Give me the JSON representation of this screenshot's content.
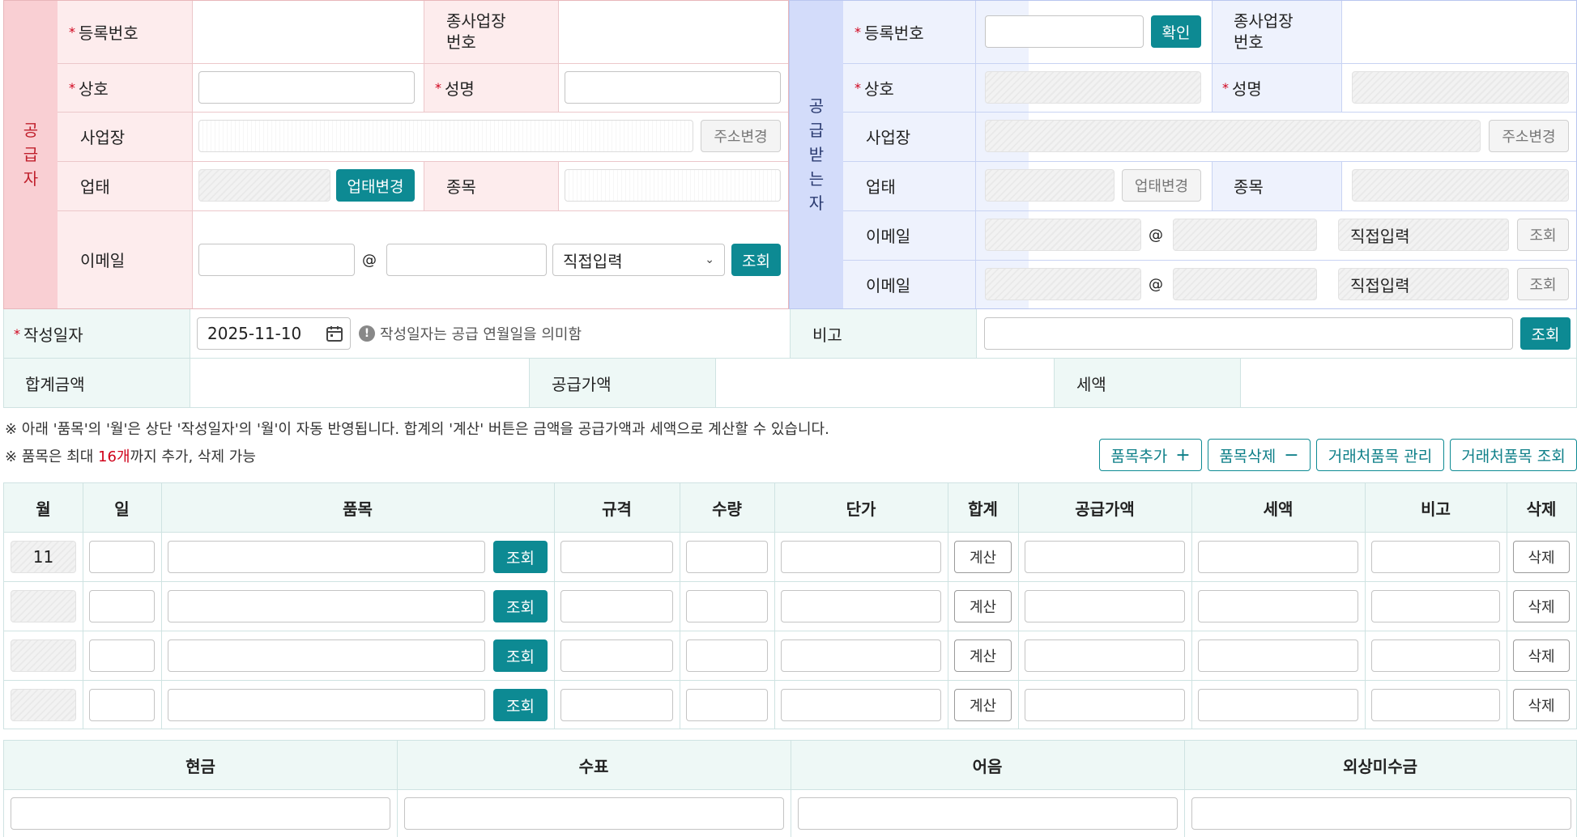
{
  "supplier": {
    "side_label": [
      "공",
      "급",
      "자"
    ],
    "reg_no": "등록번호",
    "branch_no": "종사업장\n번호",
    "company": "상호",
    "name": "성명",
    "address": "사업장",
    "addr_change": "주소변경",
    "biz_type": "업태",
    "biz_change": "업태변경",
    "biz_item": "종목",
    "email": "이메일",
    "at": "@",
    "email_domain": "직접입력",
    "lookup": "조회"
  },
  "receiver": {
    "side_label": [
      "공",
      "급",
      "받",
      "는",
      "자"
    ],
    "reg_no": "등록번호",
    "confirm": "확인",
    "branch_no": "종사업장\n번호",
    "company": "상호",
    "name": "성명",
    "address": "사업장",
    "addr_change": "주소변경",
    "biz_type": "업태",
    "biz_change": "업태변경",
    "biz_item": "종목",
    "email1": "이메일",
    "email2": "이메일",
    "at": "@",
    "email_domain": "직접입력",
    "lookup": "조회"
  },
  "date_row": {
    "label": "작성일자",
    "date": "2025-11-10",
    "hint": "작성일자는 공급 연월일을 의미함",
    "remark_label": "비고",
    "lookup": "조회"
  },
  "totals": {
    "total_label": "합계금액",
    "supply_label": "공급가액",
    "tax_label": "세액"
  },
  "notes": {
    "line1": "※ 아래 '품목'의 '월'은 상단 '작성일자'의 '월'이 자동 반영됩니다. 합계의 '계산' 버튼은 금액을 공급가액과 세액으로 계산할 수 있습니다.",
    "line2_prefix": "※ 품목은 최대 ",
    "line2_count": "16개",
    "line2_suffix": "까지 추가, 삭제 가능"
  },
  "item_buttons": {
    "add": "품목추가",
    "add_icon": "+",
    "remove": "품목삭제",
    "remove_icon": "−",
    "manage": "거래처품목 관리",
    "lookup": "거래처품목 조회"
  },
  "item_table": {
    "headers": [
      "월",
      "일",
      "품목",
      "규격",
      "수량",
      "단가",
      "합계",
      "공급가액",
      "세액",
      "비고",
      "삭제"
    ],
    "rows": [
      {
        "month": "11"
      },
      {
        "month": ""
      },
      {
        "month": ""
      },
      {
        "month": ""
      }
    ],
    "lookup": "조회",
    "calc": "계산",
    "delete": "삭제"
  },
  "payment": {
    "headers": [
      "현금",
      "수표",
      "어음",
      "외상미수금"
    ]
  },
  "colors": {
    "teal": "#0d8a93",
    "supplier_bg": "#fdeced",
    "receiver_bg": "#eef2fd",
    "supplier_side": "#f9cfd3",
    "receiver_side": "#d3dcfa",
    "mint": "#eef8f6"
  }
}
